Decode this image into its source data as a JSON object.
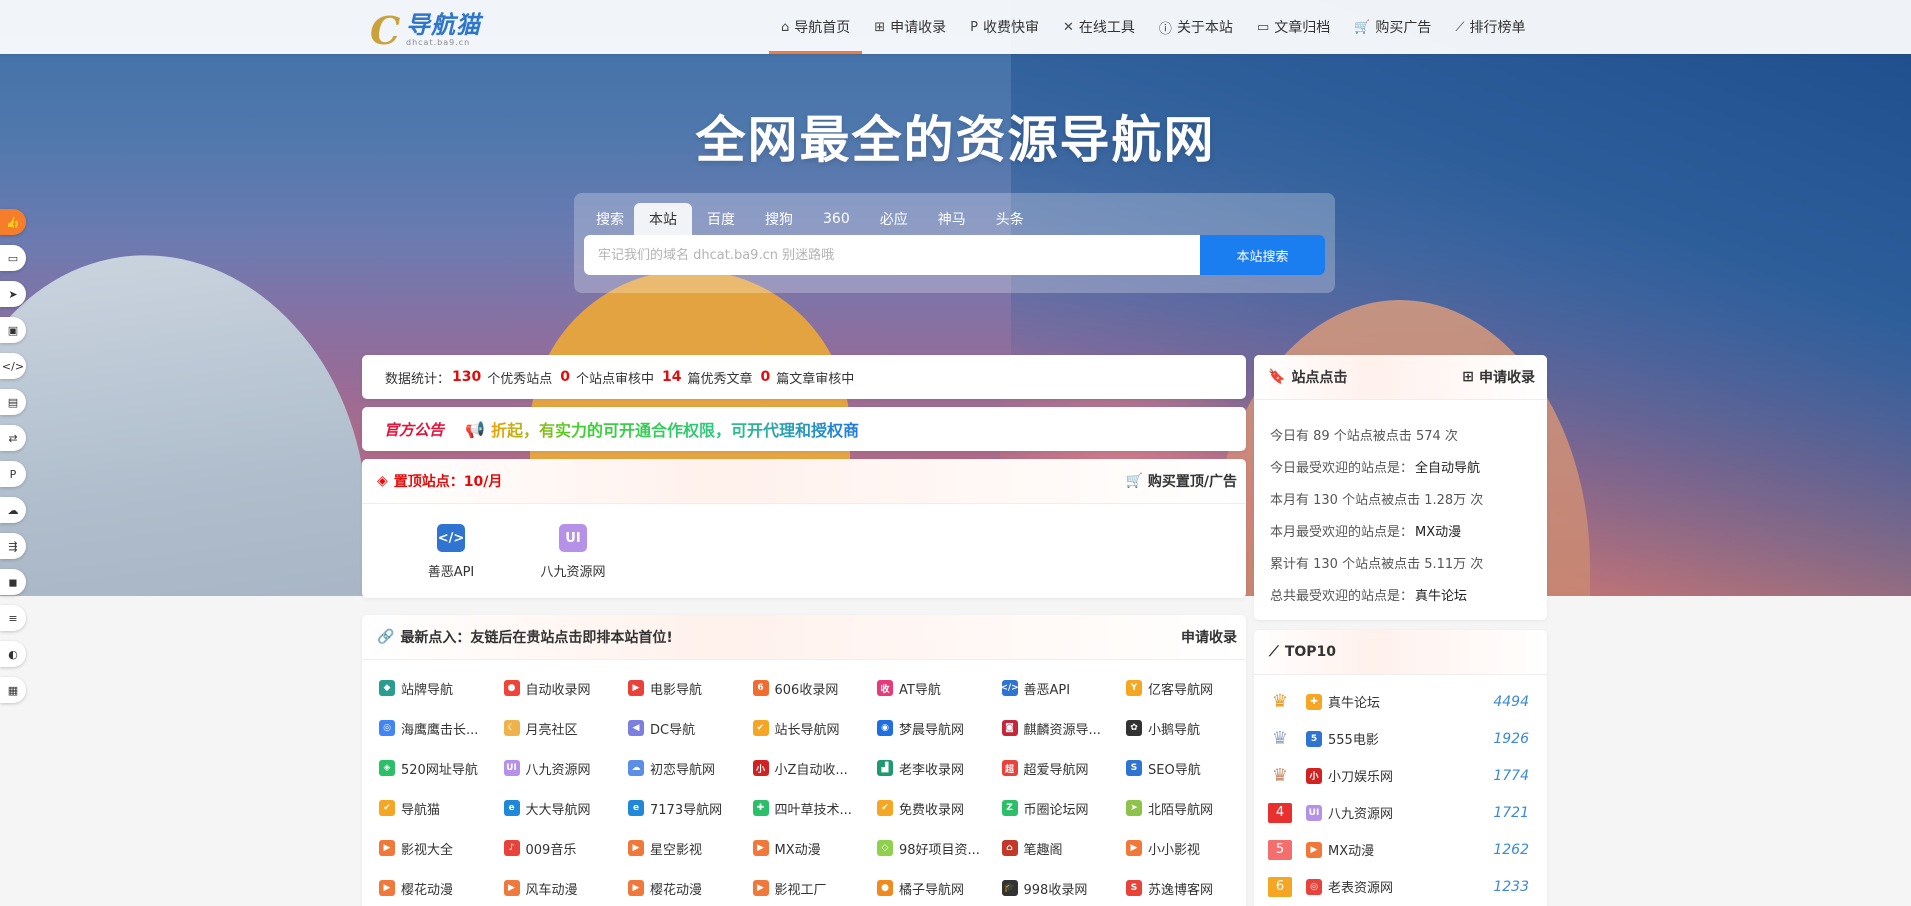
{
  "colors": {
    "accent": "#f07b3f",
    "primary_blue": "#1a7df0",
    "red": "#e10c0c",
    "count_blue": "#3b8ad8"
  },
  "logo": {
    "title": "导航猫",
    "subtitle": "dhcat.ba9.cn",
    "letter": "C"
  },
  "nav": [
    {
      "icon": "home-icon",
      "glyph": "⌂",
      "label": "导航首页"
    },
    {
      "icon": "plus-square-icon",
      "glyph": "⊞",
      "label": "申请收录"
    },
    {
      "icon": "paypal-icon",
      "glyph": "P",
      "label": "收费快审"
    },
    {
      "icon": "tools-icon",
      "glyph": "✕",
      "label": "在线工具"
    },
    {
      "icon": "info-circle-icon",
      "glyph": "ⓘ",
      "label": "关于本站"
    },
    {
      "icon": "folder-open-icon",
      "glyph": "▭",
      "label": "文章归档"
    },
    {
      "icon": "cart-icon",
      "glyph": "🛒",
      "label": "购买广告"
    },
    {
      "icon": "chart-line-icon",
      "glyph": "⟋",
      "label": "排行榜单"
    }
  ],
  "leftbar": [
    {
      "icon": "thumbs-up-icon",
      "glyph": "👍"
    },
    {
      "icon": "laptop-icon",
      "glyph": "▭"
    },
    {
      "icon": "paper-plane-icon",
      "glyph": "➤"
    },
    {
      "icon": "images-icon",
      "glyph": "▣"
    },
    {
      "icon": "code-icon",
      "glyph": "</>"
    },
    {
      "icon": "book-icon",
      "glyph": "▤"
    },
    {
      "icon": "exchange-icon",
      "glyph": "⇄"
    },
    {
      "icon": "paypal-icon",
      "glyph": "P"
    },
    {
      "icon": "cloud-download-icon",
      "glyph": "☁"
    },
    {
      "icon": "usb-icon",
      "glyph": "⇶"
    },
    {
      "icon": "shopping-bag-icon",
      "glyph": "◼"
    },
    {
      "icon": "server-icon",
      "glyph": "≡"
    },
    {
      "icon": "edge-icon",
      "glyph": "◐"
    },
    {
      "icon": "document-icon",
      "glyph": "▦"
    }
  ],
  "hero": {
    "title": "全网最全的资源导航网"
  },
  "search": {
    "label": "搜索",
    "tabs": [
      "本站",
      "百度",
      "搜狗",
      "360",
      "必应",
      "神马",
      "头条"
    ],
    "active_tab": "本站",
    "placeholder": "牢记我们的域名 dhcat.ba9.cn 别迷路哦",
    "button": "本站搜索"
  },
  "stats": {
    "label": "数据统计：",
    "items": [
      {
        "num": "130",
        "text": "个优秀站点"
      },
      {
        "num": "0",
        "text": "个站点审核中"
      },
      {
        "num": "14",
        "text": "篇优秀文章"
      },
      {
        "num": "0",
        "text": "篇文章审核中"
      }
    ]
  },
  "notice": {
    "tag": "官方公告",
    "text": "折起，有实力的可开通合作权限，可开代理和授权商"
  },
  "pinned": {
    "title": "置顶站点：10/月",
    "action": "购买置顶/广告",
    "items": [
      {
        "name": "善恶API",
        "glyph": "</>",
        "color": "#2f74d0"
      },
      {
        "name": "八九资源网",
        "glyph": "UI",
        "color": "#b691e8"
      }
    ]
  },
  "latest": {
    "title": "最新点入：友链后在贵站点击即排本站首位!",
    "action": "申请收录",
    "items": [
      {
        "name": "站牌导航",
        "glyph": "◆",
        "color": "#2a9d8f"
      },
      {
        "name": "自动收录网",
        "glyph": "●",
        "color": "#f0433a"
      },
      {
        "name": "电影导航",
        "glyph": "▶",
        "color": "#e8423b"
      },
      {
        "name": "606收录网",
        "glyph": "6",
        "color": "#f26b2f"
      },
      {
        "name": "AT导航",
        "glyph": "收",
        "color": "#e83a7a"
      },
      {
        "name": "善恶API",
        "glyph": "</>",
        "color": "#2f74d0"
      },
      {
        "name": "亿客导航网",
        "glyph": "Y",
        "color": "#f5a623"
      },
      {
        "name": "海鹰鹰击长...",
        "glyph": "◎",
        "color": "#4285f4"
      },
      {
        "name": "月亮社区",
        "glyph": "☾",
        "color": "#f0b24a"
      },
      {
        "name": "DC导航",
        "glyph": "◀",
        "color": "#7b7fe0"
      },
      {
        "name": "站长导航网",
        "glyph": "✔",
        "color": "#f5a623"
      },
      {
        "name": "梦晨导航网",
        "glyph": "◉",
        "color": "#1f6fe0"
      },
      {
        "name": "麒麟资源导...",
        "glyph": "◙",
        "color": "#c7253a"
      },
      {
        "name": "小鹅导航",
        "glyph": "✿",
        "color": "#333333"
      },
      {
        "name": "520网址导航",
        "glyph": "◈",
        "color": "#2bbf6a"
      },
      {
        "name": "八九资源网",
        "glyph": "UI",
        "color": "#b691e8"
      },
      {
        "name": "初恋导航网",
        "glyph": "☁",
        "color": "#5b8ee6"
      },
      {
        "name": "小Z自动收...",
        "glyph": "小",
        "color": "#d12222"
      },
      {
        "name": "老李收录网",
        "glyph": "▟",
        "color": "#1f9a6f"
      },
      {
        "name": "超爱导航网",
        "glyph": "超",
        "color": "#e8423b"
      },
      {
        "name": "SEO导航",
        "glyph": "S",
        "color": "#2f74d0"
      },
      {
        "name": "导航猫",
        "glyph": "✔",
        "color": "#f5a623"
      },
      {
        "name": "大大导航网",
        "glyph": "e",
        "color": "#1f88d8"
      },
      {
        "name": "7173导航网",
        "glyph": "e",
        "color": "#1f88d8"
      },
      {
        "name": "四叶草技术...",
        "glyph": "✚",
        "color": "#2bbf6a"
      },
      {
        "name": "免费收录网",
        "glyph": "✔",
        "color": "#f5a623"
      },
      {
        "name": "币圈论坛网",
        "glyph": "Z",
        "color": "#2bbf6a"
      },
      {
        "name": "北陌导航网",
        "glyph": "➤",
        "color": "#8fc24a"
      },
      {
        "name": "影视大全",
        "glyph": "▶",
        "color": "#f0783a"
      },
      {
        "name": "009音乐",
        "glyph": "♪",
        "color": "#e8423b"
      },
      {
        "name": "星空影视",
        "glyph": "▶",
        "color": "#f0783a"
      },
      {
        "name": "MX动漫",
        "glyph": "▶",
        "color": "#f0783a"
      },
      {
        "name": "98好项目资...",
        "glyph": "◇",
        "color": "#8fd14f"
      },
      {
        "name": "笔趣阁",
        "glyph": "⌂",
        "color": "#c0392b"
      },
      {
        "name": "小小影视",
        "glyph": "▶",
        "color": "#f0783a"
      },
      {
        "name": "樱花动漫",
        "glyph": "▶",
        "color": "#f0783a"
      },
      {
        "name": "风车动漫",
        "glyph": "▶",
        "color": "#f0783a"
      },
      {
        "name": "樱花动漫",
        "glyph": "▶",
        "color": "#f0783a"
      },
      {
        "name": "影视工厂",
        "glyph": "▶",
        "color": "#f0783a"
      },
      {
        "name": "橘子导航网",
        "glyph": "●",
        "color": "#f08a1c"
      },
      {
        "name": "998收录网",
        "glyph": "🎓",
        "color": "#333333"
      },
      {
        "name": "苏逸博客网",
        "glyph": "S",
        "color": "#e8423b"
      }
    ]
  },
  "site_clicks": {
    "title": "站点点击",
    "action": "申请收录",
    "rows": [
      {
        "text": "今日有 89 个站点被点击 574 次",
        "highlight": ""
      },
      {
        "text": "今日最受欢迎的站点是：",
        "highlight": "全自动导航"
      },
      {
        "text": "本月有 130 个站点被点击 1.28万 次",
        "highlight": ""
      },
      {
        "text": "本月最受欢迎的站点是：",
        "highlight": "MX动漫"
      },
      {
        "text": "累计有 130 个站点被点击 5.11万 次",
        "highlight": ""
      },
      {
        "text": "总共最受欢迎的站点是：",
        "highlight": "真牛论坛"
      }
    ]
  },
  "top10": {
    "title": "TOP10",
    "rows": [
      {
        "rank": "1",
        "crown": true,
        "rank_color": "#e89a2a",
        "name": "真牛论坛",
        "glyph": "✚",
        "color": "#f5a623",
        "count": "4494"
      },
      {
        "rank": "2",
        "crown": true,
        "rank_color": "#9aa7c7",
        "name": "555电影",
        "glyph": "5",
        "color": "#2f74d0",
        "count": "1926"
      },
      {
        "rank": "3",
        "crown": true,
        "rank_color": "#c98d6e",
        "name": "小刀娱乐网",
        "glyph": "小",
        "color": "#d12222",
        "count": "1774"
      },
      {
        "rank": "4",
        "crown": false,
        "rank_color": "#e8312f",
        "name": "八九资源网",
        "glyph": "UI",
        "color": "#b691e8",
        "count": "1721"
      },
      {
        "rank": "5",
        "crown": false,
        "rank_color": "#f46e6e",
        "name": "MX动漫",
        "glyph": "▶",
        "color": "#f0783a",
        "count": "1262"
      },
      {
        "rank": "6",
        "crown": false,
        "rank_color": "#f5a623",
        "name": "老表资源网",
        "glyph": "◎",
        "color": "#e8423b",
        "count": "1233"
      }
    ]
  }
}
